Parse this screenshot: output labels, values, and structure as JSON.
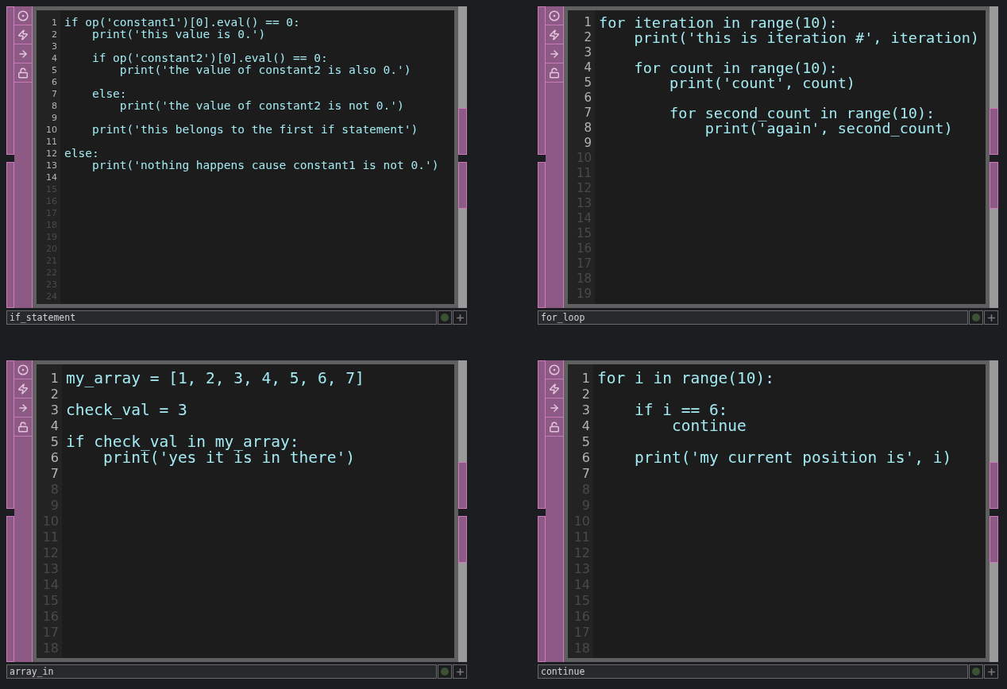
{
  "panels": [
    {
      "name": "if_statement",
      "kind": "compact",
      "lines": [
        {
          "number": "1",
          "active": true,
          "code": "if op('constant1')[0].eval() == 0:"
        },
        {
          "number": "2",
          "active": true,
          "code": "    print('this value is 0.')"
        },
        {
          "number": "3",
          "active": true
        },
        {
          "number": "4",
          "active": true,
          "code": "    if op('constant2')[0].eval() == 0:"
        },
        {
          "number": "5",
          "active": true,
          "code": "        print('the value of constant2 is also 0.')"
        },
        {
          "number": "6",
          "active": true
        },
        {
          "number": "7",
          "active": true,
          "code": "    else:"
        },
        {
          "number": "8",
          "active": true,
          "code": "        print('the value of constant2 is not 0.')"
        },
        {
          "number": "9",
          "active": true
        },
        {
          "number": "10",
          "active": true,
          "code": "    print('this belongs to the first if statement')"
        },
        {
          "number": "11",
          "active": true
        },
        {
          "number": "12",
          "active": true,
          "code": "else:"
        },
        {
          "number": "13",
          "active": true,
          "code": "    print('nothing happens cause constant1 is not 0.')"
        },
        {
          "number": "14",
          "active": true
        },
        {
          "number": "15",
          "active": false
        },
        {
          "number": "16",
          "active": false
        },
        {
          "number": "17",
          "active": false
        },
        {
          "number": "18",
          "active": false
        },
        {
          "number": "19",
          "active": false
        },
        {
          "number": "20",
          "active": false
        },
        {
          "number": "21",
          "active": false
        },
        {
          "number": "22",
          "active": false
        },
        {
          "number": "23",
          "active": false
        },
        {
          "number": "24",
          "active": false
        }
      ]
    },
    {
      "name": "for_loop",
      "kind": "medium",
      "lines": [
        {
          "number": "1",
          "active": true,
          "code": "for iteration in range(10):"
        },
        {
          "number": "2",
          "active": true,
          "code": "    print('this is iteration #', iteration)"
        },
        {
          "number": "3",
          "active": true
        },
        {
          "number": "4",
          "active": true,
          "code": "    for count in range(10):"
        },
        {
          "number": "5",
          "active": true,
          "code": "        print('count', count)"
        },
        {
          "number": "6",
          "active": true
        },
        {
          "number": "7",
          "active": true,
          "code": "        for second_count in range(10):"
        },
        {
          "number": "8",
          "active": true,
          "code": "            print('again', second_count)"
        },
        {
          "number": "9",
          "active": true
        },
        {
          "number": "10",
          "active": false
        },
        {
          "number": "11",
          "active": false
        },
        {
          "number": "12",
          "active": false
        },
        {
          "number": "13",
          "active": false
        },
        {
          "number": "14",
          "active": false
        },
        {
          "number": "15",
          "active": false
        },
        {
          "number": "16",
          "active": false
        },
        {
          "number": "17",
          "active": false
        },
        {
          "number": "18",
          "active": false
        },
        {
          "number": "19",
          "active": false
        }
      ]
    },
    {
      "name": "array_in",
      "kind": "large",
      "lines": [
        {
          "number": "1",
          "active": true,
          "code": "my_array = [1, 2, 3, 4, 5, 6, 7]"
        },
        {
          "number": "2",
          "active": true
        },
        {
          "number": "3",
          "active": true,
          "code": "check_val = 3"
        },
        {
          "number": "4",
          "active": true
        },
        {
          "number": "5",
          "active": true,
          "code": "if check_val in my_array:"
        },
        {
          "number": "6",
          "active": true,
          "code": "    print('yes it is in there')"
        },
        {
          "number": "7",
          "active": true
        },
        {
          "number": "8",
          "active": false
        },
        {
          "number": "9",
          "active": false
        },
        {
          "number": "10",
          "active": false
        },
        {
          "number": "11",
          "active": false
        },
        {
          "number": "12",
          "active": false
        },
        {
          "number": "13",
          "active": false
        },
        {
          "number": "14",
          "active": false
        },
        {
          "number": "15",
          "active": false
        },
        {
          "number": "16",
          "active": false
        },
        {
          "number": "17",
          "active": false
        },
        {
          "number": "18",
          "active": false
        }
      ]
    },
    {
      "name": "continue",
      "kind": "large",
      "lines": [
        {
          "number": "1",
          "active": true,
          "code": "for i in range(10):"
        },
        {
          "number": "2",
          "active": true
        },
        {
          "number": "3",
          "active": true,
          "code": "    if i == 6:"
        },
        {
          "number": "4",
          "active": true,
          "code": "        continue"
        },
        {
          "number": "5",
          "active": true
        },
        {
          "number": "6",
          "active": true,
          "code": "    print('my current position is', i)"
        },
        {
          "number": "7",
          "active": true
        },
        {
          "number": "8",
          "active": false
        },
        {
          "number": "9",
          "active": false
        },
        {
          "number": "10",
          "active": false
        },
        {
          "number": "11",
          "active": false
        },
        {
          "number": "12",
          "active": false
        },
        {
          "number": "13",
          "active": false
        },
        {
          "number": "14",
          "active": false
        },
        {
          "number": "15",
          "active": false
        },
        {
          "number": "16",
          "active": false
        },
        {
          "number": "17",
          "active": false
        },
        {
          "number": "18",
          "active": false
        }
      ]
    }
  ]
}
